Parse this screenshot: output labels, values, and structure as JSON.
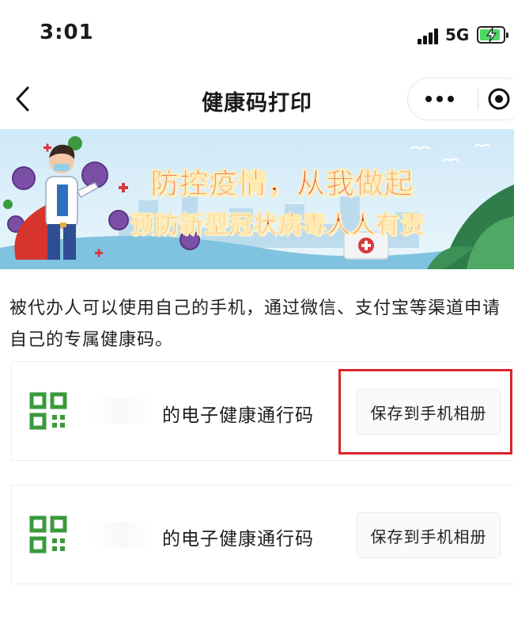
{
  "status_bar": {
    "time": "3:01",
    "network": "5G",
    "battery_level": 0.9
  },
  "nav": {
    "title": "健康码打印",
    "back_icon": "chevron-left-icon",
    "more_icon": "more-dots-icon",
    "close_icon": "mini-program-close-icon"
  },
  "banner": {
    "line1": "防控疫情，从我做起",
    "line2": "预防新型冠状病毒人人有责"
  },
  "intro_text": "被代办人可以使用自己的手机，通过微信、支付宝等渠道申请自己的专属健康码。",
  "cards": [
    {
      "label": "的电子健康通行码",
      "button": "保存到手机相册",
      "icon": "qr-code-icon"
    },
    {
      "label": "的电子健康通行码",
      "button": "保存到手机相册",
      "icon": "qr-code-icon"
    }
  ],
  "colors": {
    "qr_green": "#3a9a3c",
    "highlight_red": "#d9252a",
    "banner_text_red": "#c91a1a"
  }
}
